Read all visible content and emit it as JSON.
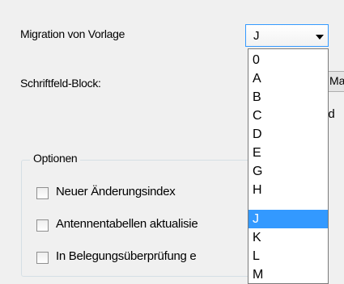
{
  "dialog": {
    "migration_label": "Migration von Vorlage",
    "schriftfeld_label": "Schriftfeld-Block:",
    "ma_partial": "Ma",
    "ld_partial": "ld"
  },
  "template_combo": {
    "selected": "J",
    "options": [
      "0",
      "A",
      "B",
      "C",
      "D",
      "E",
      "G",
      "H",
      "J",
      "K",
      "L",
      "M"
    ]
  },
  "options_group": {
    "title": "Optionen",
    "checkboxes": [
      {
        "label": "Neuer Änderungsindex",
        "checked": false
      },
      {
        "label": "Antennentabellen aktualisie",
        "checked": false
      },
      {
        "label": "In Belegungsüberprüfung e",
        "checked": false
      }
    ]
  },
  "colors": {
    "selection": "#3399ff",
    "background": "#f0f0f0"
  },
  "icons": {
    "combo_arrow": "chevron-down-icon"
  }
}
